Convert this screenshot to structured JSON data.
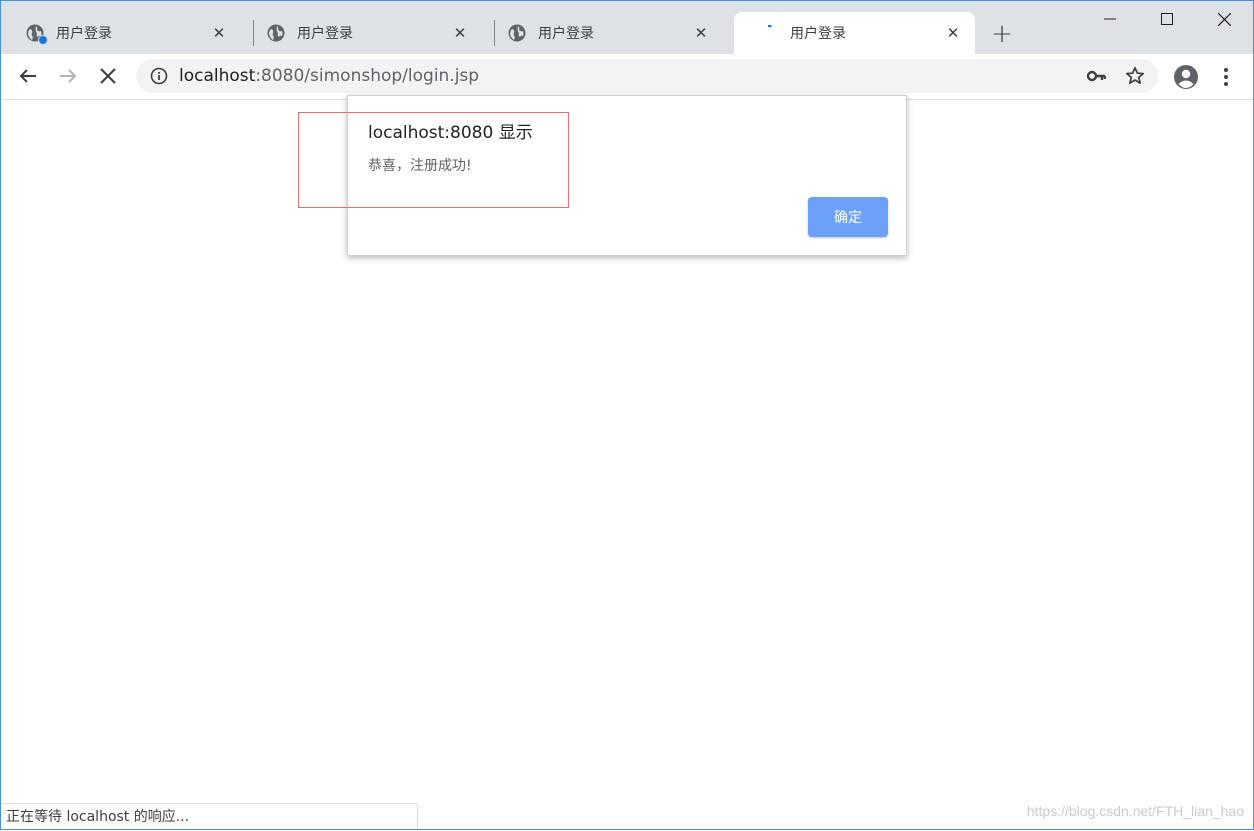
{
  "tabs": [
    {
      "title": "用户登录",
      "state": "normal",
      "badge": true
    },
    {
      "title": "用户登录",
      "state": "normal",
      "badge": false
    },
    {
      "title": "用户登录",
      "state": "normal",
      "badge": false
    },
    {
      "title": "用户登录",
      "state": "loading",
      "badge": false
    }
  ],
  "toolbar": {
    "url_host": "localhost",
    "url_rest": ":8080/simonshop/login.jsp"
  },
  "dialog": {
    "title": "localhost:8080 显示",
    "message": "恭喜，注册成功!",
    "ok_label": "确定"
  },
  "status": {
    "text": "正在等待 localhost 的响应..."
  },
  "watermark": {
    "text": "https://blog.csdn.net/FTH_lian_hao"
  },
  "colors": {
    "accent": "#6da1f7",
    "tabstrip": "#dee1e6",
    "annotation": "#e57373",
    "badge": "#1a73e8"
  },
  "icons": {
    "tab_favicon": "globe-icon",
    "loading": "spinner-icon",
    "back": "arrow-left-icon",
    "forward": "arrow-right-icon",
    "stop": "close-icon",
    "info": "info-icon",
    "key": "key-icon",
    "star": "star-icon",
    "account": "account-icon",
    "menu": "kebab-menu-icon"
  }
}
